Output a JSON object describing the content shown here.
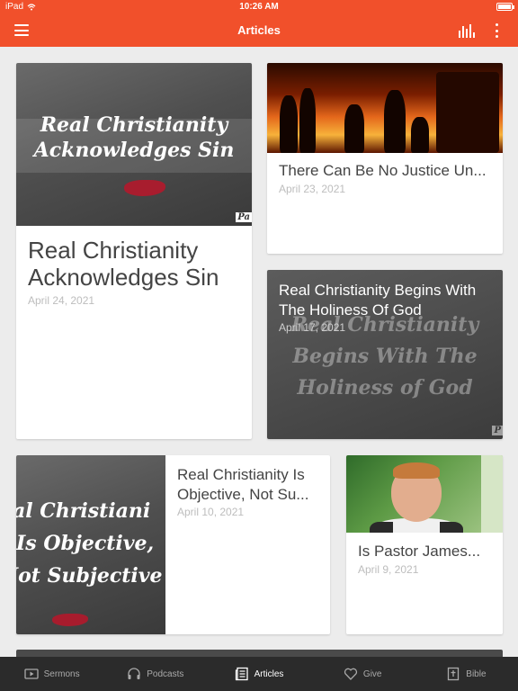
{
  "status_bar": {
    "device": "iPad",
    "time": "10:26 AM"
  },
  "app_bar": {
    "title": "Articles"
  },
  "articles": [
    {
      "title": "Real Christianity Acknowledges Sin",
      "date": "April 24, 2021",
      "image_text": [
        "Real Christianity",
        "Acknowledges Sin"
      ],
      "image_corner": "Pa"
    },
    {
      "title": "There Can Be No Justice Un...",
      "date": "April 23, 2021"
    },
    {
      "title": "Real Christianity Begins With The Holiness Of God",
      "date": "April 17, 2021",
      "image_text": [
        "Real Christianity",
        "Begins With The",
        "Holiness of God"
      ],
      "image_corner": "P"
    },
    {
      "title": "Real Christianity Is Objective, Not Su...",
      "date": "April 10, 2021",
      "image_text": [
        "eal Christiani",
        "Is Objective,",
        "Not Subjective"
      ]
    },
    {
      "title": "Is Pastor James...",
      "date": "April 9, 2021"
    }
  ],
  "tabs": [
    {
      "label": "Sermons",
      "icon": "video-icon"
    },
    {
      "label": "Podcasts",
      "icon": "headphones-icon"
    },
    {
      "label": "Articles",
      "icon": "newspaper-icon"
    },
    {
      "label": "Give",
      "icon": "heart-icon"
    },
    {
      "label": "Bible",
      "icon": "bible-icon"
    }
  ],
  "colors": {
    "accent": "#f1502b",
    "tabbar": "#2b2b2b"
  }
}
